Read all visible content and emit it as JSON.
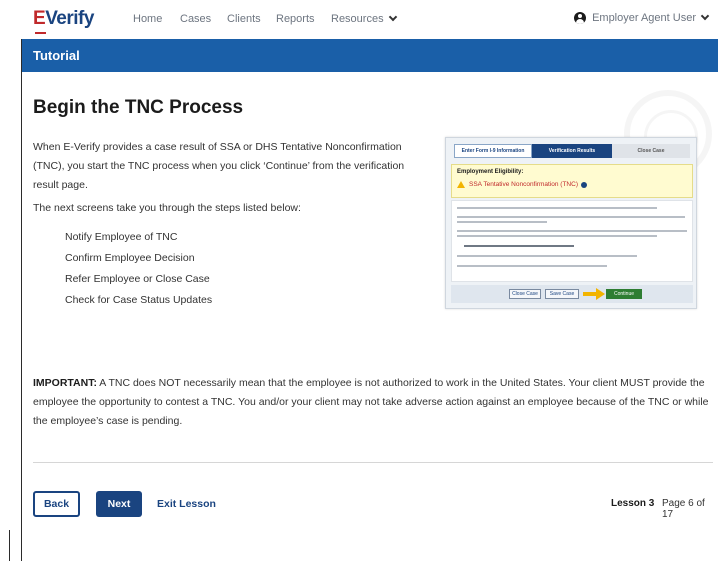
{
  "nav": {
    "logo_e": "E",
    "logo_rest": "Verify",
    "items": [
      "Home",
      "Cases",
      "Clients",
      "Reports",
      "Resources"
    ],
    "user": "Employer Agent User"
  },
  "banner": {
    "title": "Tutorial"
  },
  "content": {
    "heading": "Begin the TNC Process",
    "intro": "When E-Verify provides a case result of SSA or DHS Tentative Nonconfirmation (TNC), you start the TNC process when you click ‘Continue’ from the verification result page.",
    "steps_lead": "The next screens take you through the steps listed below:",
    "steps": [
      "Notify Employee of TNC",
      "Confirm Employee Decision",
      "Refer Employee or Close Case",
      "Check for Case Status Updates"
    ],
    "important_label": "IMPORTANT:",
    "important_text": " A TNC does NOT necessarily mean that the employee is not authorized to work in the United States. Your client MUST provide the employee the opportunity to contest a TNC. You and/or your client may not take adverse action against an employee because of the TNC or while the employee’s case is pending."
  },
  "thumbnail": {
    "steps": [
      "Enter Form I-9 Information",
      "Verification Results",
      "Close Case"
    ],
    "eligibility_label": "Employment Eligibility:",
    "status": "SSA Tentative Nonconfirmation (TNC)",
    "buttons": [
      "Close Case",
      "Save Case",
      "Continue"
    ]
  },
  "footer": {
    "back": "Back",
    "next": "Next",
    "exit": "Exit Lesson",
    "lesson": "Lesson 3",
    "page": "Page 6 of 17"
  },
  "colors": {
    "primary": "#1a4480",
    "banner": "#1a5fa8",
    "accent_red": "#c0292b",
    "warning_yellow": "#f2b400"
  }
}
